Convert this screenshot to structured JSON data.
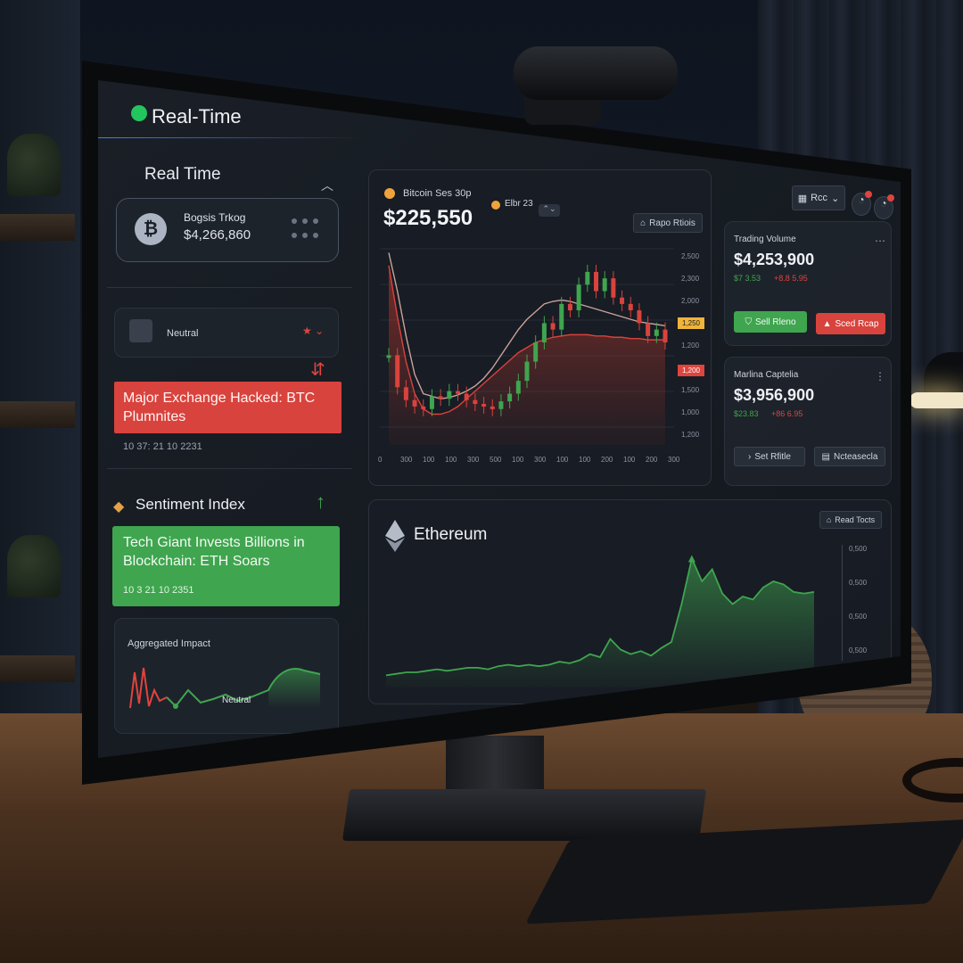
{
  "header": {
    "title": "Real-Time",
    "live_color": "#22c55e"
  },
  "sidebar": {
    "section_title": "Real Time",
    "ticker": {
      "name": "Bogsis Trkog",
      "value": "$4,266,860",
      "icon": "bitcoin-icon"
    },
    "sentiment_select": {
      "value": "Neutral"
    },
    "alert_bad": {
      "headline": "Major Exchange Hacked: BTC Plumnites",
      "timestamp": "10 37: 21 10 2231",
      "color": "#e0443e"
    },
    "sentiment_title": "Sentiment Index",
    "alert_good": {
      "headline": "Tech Giant Invests Billions in Blockchain: ETH Soars",
      "timestamp": "10 3 21 10 2351",
      "color": "#3fa54f"
    },
    "impact": {
      "title": "Aggregated Impact",
      "label": "Neutral"
    }
  },
  "btc": {
    "pair_label": "Bitcoin Ses 30p",
    "pair2_label": "Elbr 23",
    "price": "$225,550",
    "action_label": "Rapo Rtiois",
    "y_ticks": [
      "2,500",
      "2,300",
      "2,000",
      "1,500",
      "1,200",
      "1,000",
      "1,500",
      "1,000",
      "1,200"
    ],
    "price_tags": [
      "1,250",
      "1,200"
    ],
    "x_ticks": [
      "0",
      "300",
      "100",
      "100",
      "300",
      "500",
      "100",
      "300",
      "100",
      "100",
      "200",
      "100",
      "200",
      "300"
    ]
  },
  "right": {
    "menu_label": "Rcc",
    "volume": {
      "title": "Trading Volume",
      "value": "$4,253,900",
      "delta_up": "$7 3.53",
      "delta_down": "+8.8 5.95"
    },
    "buy_label": "Sell Rleno",
    "sell_label": "Sced Rcap",
    "mcap": {
      "title": "Marlina Captelia",
      "value": "$3,956,900",
      "delta_up": "$23.83",
      "delta_down": "+86 6.95"
    },
    "btn1_label": "Set Rfitle",
    "btn2_label": "Ncteasecla"
  },
  "eth": {
    "title": "Ethereum",
    "action_label": "Read Tocts",
    "y_ticks": [
      "0,500",
      "0,500",
      "0,500",
      "0,500"
    ]
  },
  "chart_data": [
    {
      "type": "candlestick",
      "title": "Bitcoin Ses 30p",
      "series": [
        {
          "name": "price",
          "values": [
            1.3,
            1.05,
            0.95,
            0.9,
            0.88,
            0.98,
            0.96,
            1.02,
            1.0,
            0.95,
            0.92,
            0.9,
            0.88,
            0.94,
            1.0,
            1.1,
            1.25,
            1.4,
            1.55,
            1.5,
            1.7,
            1.65,
            1.85,
            1.95,
            1.8,
            1.9,
            1.75,
            1.7,
            1.65,
            1.55,
            1.45,
            1.5,
            1.4
          ]
        }
      ],
      "overlay": [
        {
          "name": "ma-fast",
          "values": [
            2.1,
            1.8,
            1.45,
            1.15,
            1.0,
            0.98,
            0.96,
            0.97,
            0.99,
            1.02,
            1.06,
            1.12,
            1.2,
            1.3,
            1.4,
            1.5,
            1.58,
            1.64,
            1.7,
            1.72,
            1.73,
            1.72,
            1.7,
            1.68,
            1.66,
            1.64,
            1.62,
            1.6,
            1.58,
            1.56,
            1.55,
            1.54,
            1.53
          ]
        },
        {
          "name": "ma-slow",
          "values": [
            2.0,
            1.6,
            1.25,
            1.0,
            0.88,
            0.84,
            0.84,
            0.86,
            0.9,
            0.96,
            1.02,
            1.08,
            1.14,
            1.2,
            1.26,
            1.32,
            1.36,
            1.4,
            1.42,
            1.44,
            1.45,
            1.46,
            1.46,
            1.46,
            1.45,
            1.45,
            1.44,
            1.44,
            1.43,
            1.43,
            1.42,
            1.42,
            1.42
          ]
        }
      ]
    },
    {
      "type": "area",
      "title": "Ethereum",
      "values": [
        0.08,
        0.09,
        0.1,
        0.1,
        0.11,
        0.12,
        0.11,
        0.12,
        0.13,
        0.13,
        0.12,
        0.14,
        0.15,
        0.14,
        0.15,
        0.14,
        0.15,
        0.17,
        0.16,
        0.18,
        0.22,
        0.2,
        0.32,
        0.25,
        0.22,
        0.24,
        0.21,
        0.26,
        0.3,
        0.55,
        0.85,
        0.7,
        0.78,
        0.62,
        0.55,
        0.6,
        0.58,
        0.66,
        0.7,
        0.68,
        0.63,
        0.62,
        0.63
      ]
    }
  ]
}
